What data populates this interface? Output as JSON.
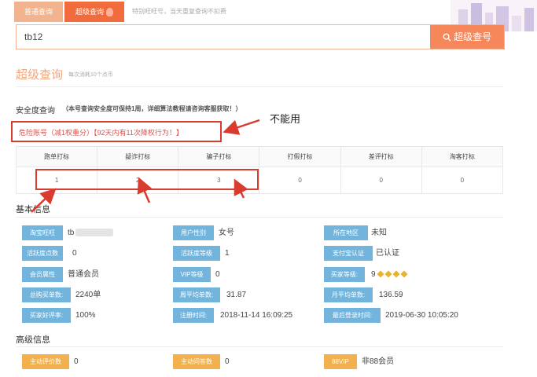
{
  "tabs": {
    "normal": "普通查询",
    "super": "超级查询"
  },
  "top_note": "特别旺旺号，当天重复查询不扣费",
  "search": {
    "value": "tb12",
    "button": "超级查号"
  },
  "section": {
    "title": "超级查询",
    "sub": "每次消耗10个点币"
  },
  "safety": {
    "title": "安全度查询",
    "note": "（本号查询安全度可保持1周，详细算法教程请咨询客服获取！）",
    "danger": "危险账号（减1权重分）【92天内有11次降权行为！】"
  },
  "annotation": "不能用",
  "tag_table": {
    "headers": [
      "跑单打标",
      "疑诈打标",
      "骗子打标",
      "打假打标",
      "差评打标",
      "淘客打标"
    ],
    "values": [
      "1",
      "2",
      "3",
      "0",
      "0",
      "0"
    ]
  },
  "basic": {
    "title": "基本信息",
    "rows": [
      [
        {
          "label": "淘宝旺旺",
          "value": "tb"
        },
        {
          "label": "用户性别",
          "value": "女号"
        },
        {
          "label": "所在地区",
          "value": "未知"
        }
      ],
      [
        {
          "label": "活跃度点数",
          "value": "0"
        },
        {
          "label": "活跃度等级",
          "value": "1"
        },
        {
          "label": "支付宝认证",
          "value": "已认证"
        }
      ],
      [
        {
          "label": "会员属性",
          "value": "普通会员"
        },
        {
          "label": "VIP等级",
          "value": "0"
        },
        {
          "label": "买家等级:",
          "value": "9"
        }
      ],
      [
        {
          "label": "总购买单数:",
          "value": "2240单"
        },
        {
          "label": "周平均单数:",
          "value": "31.87"
        },
        {
          "label": "月平均单数:",
          "value": "136.59"
        }
      ],
      [
        {
          "label": "买家好评率:",
          "value": "100%"
        },
        {
          "label": "注册时间:",
          "value": "2018-11-14 16:09:25"
        },
        {
          "label": "最后登录时间:",
          "value": "2019-06-30 10:05:20"
        }
      ]
    ]
  },
  "advanced": {
    "title": "高级信息",
    "items": [
      {
        "label": "主动评价数",
        "value": "0"
      },
      {
        "label": "主动问答数",
        "value": "0"
      },
      {
        "label": "88VIP",
        "value": "非88会员"
      }
    ]
  },
  "colors": {
    "accent": "#f5875a",
    "label_blue": "#72b4dc",
    "label_orange": "#f2b04e",
    "alert_red": "#d93b2e"
  },
  "icons": {
    "search": "search-icon",
    "fire": "fire-icon",
    "diamond": "diamond-icon"
  }
}
